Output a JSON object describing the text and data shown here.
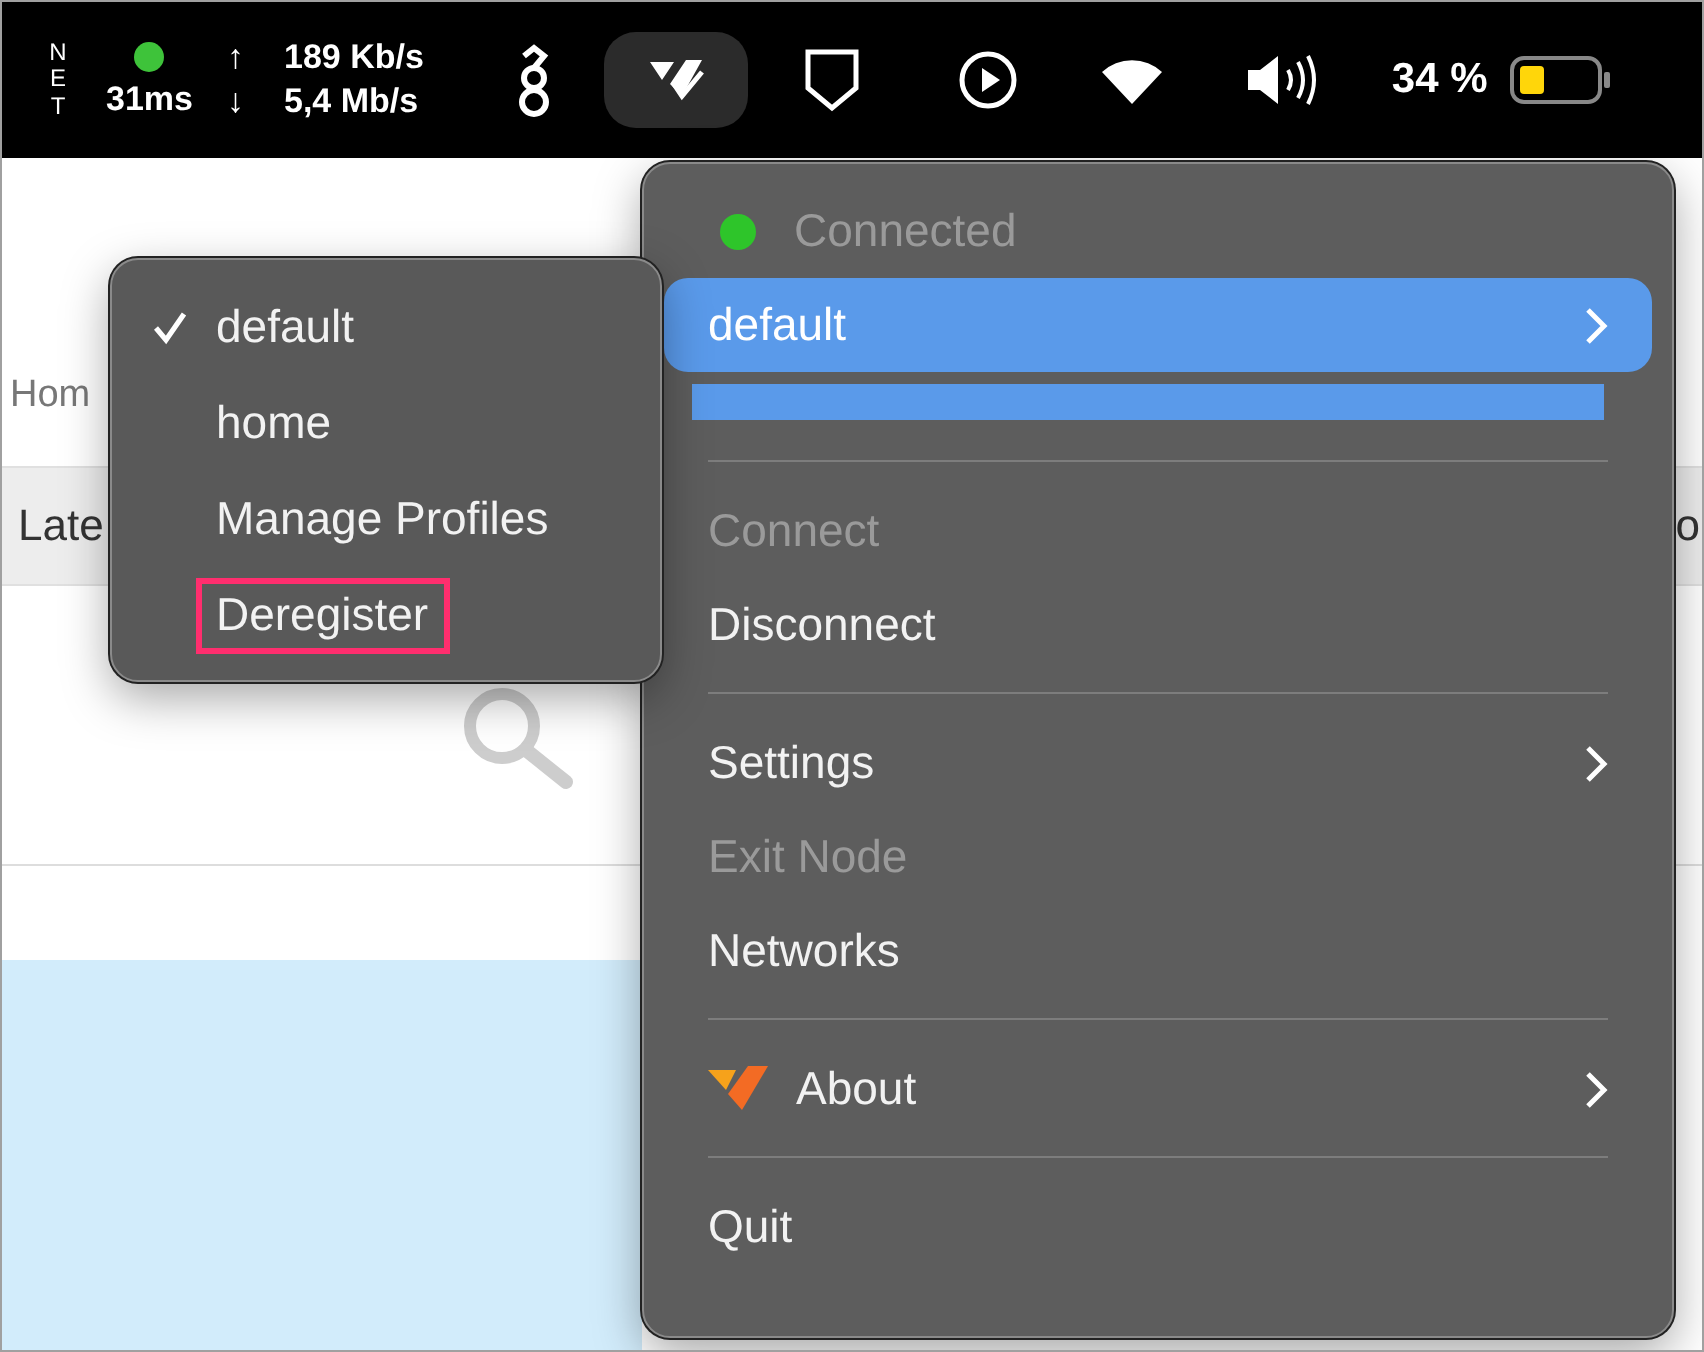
{
  "menu_bar": {
    "net_label": "NET",
    "latency": "31ms",
    "upload_arrow": "↑",
    "download_arrow": "↓",
    "upload": "189 Kb/s",
    "download": "5,4 Mb/s",
    "tray_icons": [
      {
        "kind": "dragon",
        "selected": false
      },
      {
        "kind": "netbird",
        "selected": true
      },
      {
        "kind": "shield",
        "selected": false
      },
      {
        "kind": "play",
        "selected": false
      },
      {
        "kind": "wifi",
        "selected": false
      },
      {
        "kind": "volume",
        "selected": false
      }
    ],
    "battery_text": "34 %"
  },
  "background_page": {
    "breadcrumb": "Hom",
    "tab_left": "Late",
    "tab_right": "o"
  },
  "main_menu": [
    {
      "kind": "status",
      "label": "Connected",
      "disabled": true
    },
    {
      "kind": "item",
      "label": "default",
      "disabled": false,
      "selected": true,
      "submenu": true,
      "logo": false
    },
    {
      "kind": "redacted"
    },
    {
      "kind": "separator"
    },
    {
      "kind": "item",
      "label": "Connect",
      "disabled": true,
      "selected": false,
      "submenu": false,
      "logo": false
    },
    {
      "kind": "item",
      "label": "Disconnect",
      "disabled": false,
      "selected": false,
      "submenu": false,
      "logo": false
    },
    {
      "kind": "separator"
    },
    {
      "kind": "item",
      "label": "Settings",
      "disabled": false,
      "selected": false,
      "submenu": true,
      "logo": false
    },
    {
      "kind": "item",
      "label": "Exit Node",
      "disabled": true,
      "selected": false,
      "submenu": false,
      "logo": false
    },
    {
      "kind": "item",
      "label": "Networks",
      "disabled": false,
      "selected": false,
      "submenu": false,
      "logo": false
    },
    {
      "kind": "separator"
    },
    {
      "kind": "item",
      "label": "About",
      "disabled": false,
      "selected": false,
      "submenu": true,
      "logo": true
    },
    {
      "kind": "separator"
    },
    {
      "kind": "item",
      "label": "Quit",
      "disabled": false,
      "selected": false,
      "submenu": false,
      "logo": false
    }
  ],
  "profile_submenu": [
    {
      "label": "default",
      "checked": true,
      "annotated": false
    },
    {
      "label": "home",
      "checked": false,
      "annotated": false
    },
    {
      "label": "Manage Profiles",
      "checked": false,
      "annotated": false
    },
    {
      "label": "Deregister",
      "checked": false,
      "annotated": true
    }
  ]
}
